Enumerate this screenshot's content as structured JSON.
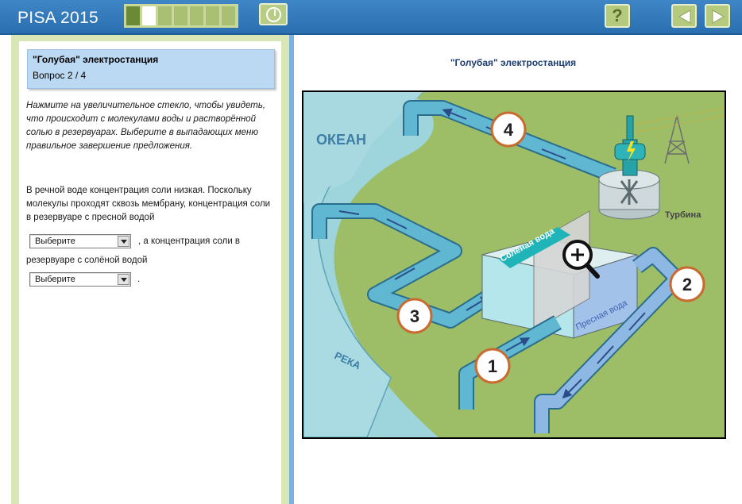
{
  "header": {
    "app_title": "PISA 2015",
    "progress": {
      "total": 7,
      "completed": 1,
      "current": 2
    },
    "help_label": "?"
  },
  "question": {
    "title": "\"Голубая\" электростанция",
    "number": "Вопрос 2 / 4",
    "instruction": "Нажмите на увеличительное стекло, чтобы увидеть, что происходит с молекулами воды и растворённой солью в резервуарах. Выберите в выпадающих меню правильное завершение предложения.",
    "text_part1": "В речной воде концентрация соли низкая. Поскольку молекулы проходят сквозь мембрану, концентрация соли в резервуаре с пресной водой",
    "text_part2": ", а концентрация соли в",
    "text_part3": "резервуаре с солёной водой",
    "text_end": ".",
    "dropdown1_value": "Выберите",
    "dropdown2_value": "Выберите"
  },
  "stimulus": {
    "title": "\"Голубая\" электростанция",
    "labels": {
      "ocean": "ОКЕАН",
      "river": "РЕКА",
      "turbine": "Турбина",
      "salt_water": "Солёная вода",
      "fresh_water": "Пресная вода"
    },
    "markers": [
      "1",
      "2",
      "3",
      "4"
    ]
  },
  "colors": {
    "topbar": "#2f78bb",
    "land": "#9fbf6a",
    "ocean": "#a7d8de",
    "pipe": "#5fb3cf",
    "salt_tank_label": "#1fb5b8"
  }
}
